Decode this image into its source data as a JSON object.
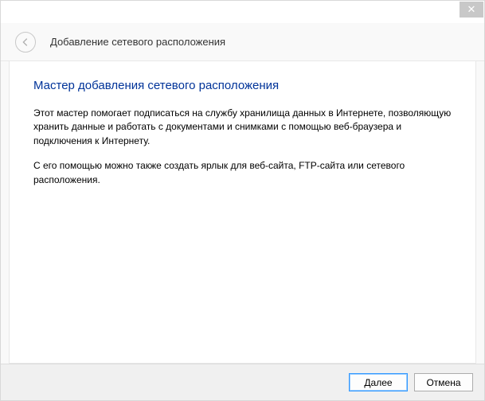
{
  "window": {
    "title": "Добавление сетевого расположения"
  },
  "wizard": {
    "heading": "Мастер добавления сетевого расположения",
    "paragraph1": "Этот мастер помогает подписаться на службу хранилища данных в Интернете, позволяющую хранить данные и работать с документами и снимками с помощью веб-браузера и подключения к Интернету.",
    "paragraph2": "С его помощью можно также создать ярлык для веб-сайта, FTP-сайта или сетевого расположения."
  },
  "buttons": {
    "next": "Далее",
    "cancel": "Отмена"
  }
}
